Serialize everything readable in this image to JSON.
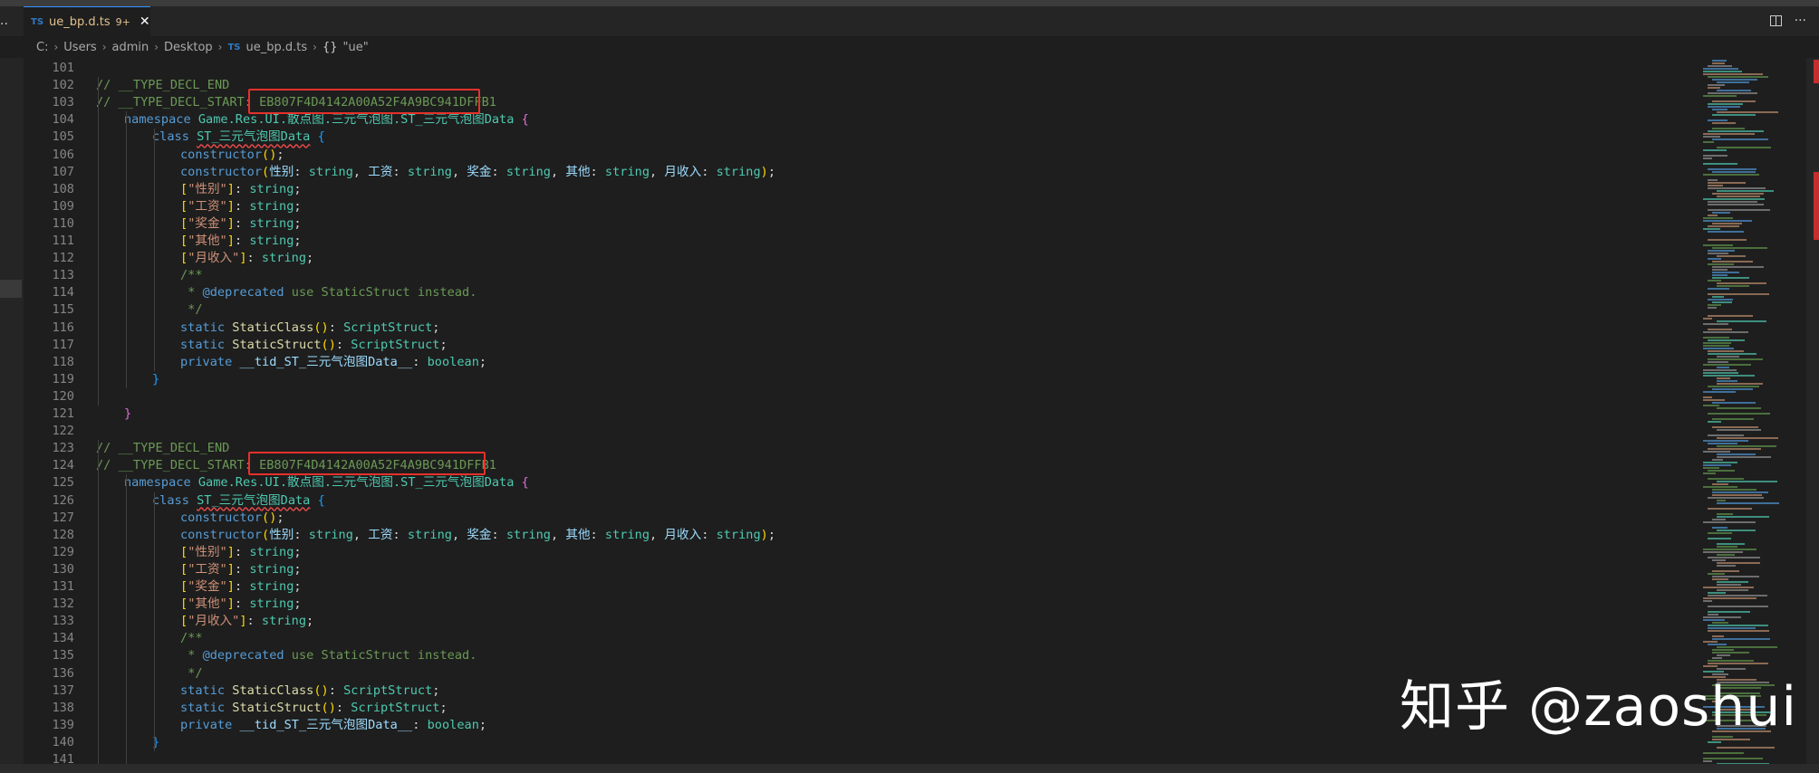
{
  "window": {
    "left_menu": "··"
  },
  "tab": {
    "lang_icon": "TS",
    "filename": "ue_bp.d.ts",
    "problems_badge": "9+",
    "close": "✕"
  },
  "tab_actions": {
    "more": "···"
  },
  "breadcrumb": {
    "items": [
      "C:",
      "Users",
      "admin",
      "Desktop",
      "ue_bp.d.ts",
      "\"ue\""
    ],
    "file_icon": "TS",
    "symbol_icon": "{}"
  },
  "editor": {
    "lines": [
      {
        "n": "101",
        "indent": 0,
        "tokens": []
      },
      {
        "n": "102",
        "indent": 0,
        "tokens": [
          [
            "c-cmt",
            "// __TYPE_DECL_END"
          ]
        ]
      },
      {
        "n": "103",
        "indent": 0,
        "tokens": [
          [
            "c-cmt",
            "// __TYPE_DECL_START: "
          ],
          [
            "c-hash",
            "EB807F4D4142A00A52F4A9BC941DFFB1"
          ]
        ]
      },
      {
        "n": "104",
        "indent": 1,
        "tokens": [
          [
            "c-kw",
            "namespace "
          ],
          [
            "c-type",
            "Game.Res.UI.散点图.三元气泡图.ST_三元气泡图Data "
          ],
          [
            "c-b2",
            "{"
          ]
        ]
      },
      {
        "n": "105",
        "indent": 2,
        "tokens": [
          [
            "c-kw",
            "class "
          ],
          [
            "c-type squig",
            "ST_三元气泡图Data"
          ],
          [
            "c-p",
            " "
          ],
          [
            "c-b3",
            "{"
          ]
        ]
      },
      {
        "n": "106",
        "indent": 3,
        "tokens": [
          [
            "c-kw",
            "constructor"
          ],
          [
            "c-b1",
            "()"
          ],
          [
            "c-p",
            ";"
          ]
        ]
      },
      {
        "n": "107",
        "indent": 3,
        "tokens": [
          [
            "c-kw",
            "constructor"
          ],
          [
            "c-b1",
            "("
          ],
          [
            "c-var",
            "性别"
          ],
          [
            "c-p",
            ": "
          ],
          [
            "c-type",
            "string"
          ],
          [
            "c-p",
            ", "
          ],
          [
            "c-var",
            "工资"
          ],
          [
            "c-p",
            ": "
          ],
          [
            "c-type",
            "string"
          ],
          [
            "c-p",
            ", "
          ],
          [
            "c-var",
            "奖金"
          ],
          [
            "c-p",
            ": "
          ],
          [
            "c-type",
            "string"
          ],
          [
            "c-p",
            ", "
          ],
          [
            "c-var",
            "其他"
          ],
          [
            "c-p",
            ": "
          ],
          [
            "c-type",
            "string"
          ],
          [
            "c-p",
            ", "
          ],
          [
            "c-var",
            "月收入"
          ],
          [
            "c-p",
            ": "
          ],
          [
            "c-type",
            "string"
          ],
          [
            "c-b1",
            ")"
          ],
          [
            "c-p",
            ";"
          ]
        ]
      },
      {
        "n": "108",
        "indent": 3,
        "tokens": [
          [
            "c-b1",
            "["
          ],
          [
            "c-str",
            "\"性别\""
          ],
          [
            "c-b1",
            "]"
          ],
          [
            "c-p",
            ": "
          ],
          [
            "c-type",
            "string"
          ],
          [
            "c-p",
            ";"
          ]
        ]
      },
      {
        "n": "109",
        "indent": 3,
        "tokens": [
          [
            "c-b1",
            "["
          ],
          [
            "c-str",
            "\"工资\""
          ],
          [
            "c-b1",
            "]"
          ],
          [
            "c-p",
            ": "
          ],
          [
            "c-type",
            "string"
          ],
          [
            "c-p",
            ";"
          ]
        ]
      },
      {
        "n": "110",
        "indent": 3,
        "tokens": [
          [
            "c-b1",
            "["
          ],
          [
            "c-str",
            "\"奖金\""
          ],
          [
            "c-b1",
            "]"
          ],
          [
            "c-p",
            ": "
          ],
          [
            "c-type",
            "string"
          ],
          [
            "c-p",
            ";"
          ]
        ]
      },
      {
        "n": "111",
        "indent": 3,
        "tokens": [
          [
            "c-b1",
            "["
          ],
          [
            "c-str",
            "\"其他\""
          ],
          [
            "c-b1",
            "]"
          ],
          [
            "c-p",
            ": "
          ],
          [
            "c-type",
            "string"
          ],
          [
            "c-p",
            ";"
          ]
        ]
      },
      {
        "n": "112",
        "indent": 3,
        "tokens": [
          [
            "c-b1",
            "["
          ],
          [
            "c-str",
            "\"月收入\""
          ],
          [
            "c-b1",
            "]"
          ],
          [
            "c-p",
            ": "
          ],
          [
            "c-type",
            "string"
          ],
          [
            "c-p",
            ";"
          ]
        ]
      },
      {
        "n": "113",
        "indent": 3,
        "tokens": [
          [
            "c-cmt",
            "/**"
          ]
        ]
      },
      {
        "n": "114",
        "indent": 3,
        "tokens": [
          [
            "c-cmt",
            " * "
          ],
          [
            "c-kw",
            "@deprecated"
          ],
          [
            "c-cmt",
            " use StaticStruct instead."
          ]
        ]
      },
      {
        "n": "115",
        "indent": 3,
        "tokens": [
          [
            "c-cmt",
            " */"
          ]
        ]
      },
      {
        "n": "116",
        "indent": 3,
        "tokens": [
          [
            "c-kw",
            "static "
          ],
          [
            "c-fn",
            "StaticClass"
          ],
          [
            "c-b1",
            "()"
          ],
          [
            "c-p",
            ": "
          ],
          [
            "c-type",
            "ScriptStruct"
          ],
          [
            "c-p",
            ";"
          ]
        ]
      },
      {
        "n": "117",
        "indent": 3,
        "tokens": [
          [
            "c-kw",
            "static "
          ],
          [
            "c-fn",
            "StaticStruct"
          ],
          [
            "c-b1",
            "()"
          ],
          [
            "c-p",
            ": "
          ],
          [
            "c-type",
            "ScriptStruct"
          ],
          [
            "c-p",
            ";"
          ]
        ]
      },
      {
        "n": "118",
        "indent": 3,
        "tokens": [
          [
            "c-kw",
            "private "
          ],
          [
            "c-var",
            "__tid_ST_三元气泡图Data__"
          ],
          [
            "c-p",
            ": "
          ],
          [
            "c-type",
            "boolean"
          ],
          [
            "c-p",
            ";"
          ]
        ]
      },
      {
        "n": "119",
        "indent": 2,
        "tokens": [
          [
            "c-b3",
            "}"
          ]
        ]
      },
      {
        "n": "120",
        "indent": 0,
        "tokens": []
      },
      {
        "n": "121",
        "indent": 1,
        "tokens": [
          [
            "c-b2",
            "}"
          ]
        ]
      },
      {
        "n": "122",
        "indent": 0,
        "tokens": []
      },
      {
        "n": "123",
        "indent": 0,
        "tokens": [
          [
            "c-cmt",
            "// __TYPE_DECL_END"
          ]
        ]
      },
      {
        "n": "124",
        "indent": 0,
        "tokens": [
          [
            "c-cmt",
            "// __TYPE_DECL_START: "
          ],
          [
            "c-hash",
            "EB807F4D4142A00A52F4A9BC941DFFB1"
          ]
        ]
      },
      {
        "n": "125",
        "indent": 1,
        "tokens": [
          [
            "c-kw",
            "namespace "
          ],
          [
            "c-type",
            "Game.Res.UI.散点图.三元气泡图.ST_三元气泡图Data "
          ],
          [
            "c-b2",
            "{"
          ]
        ]
      },
      {
        "n": "126",
        "indent": 2,
        "tokens": [
          [
            "c-kw",
            "class "
          ],
          [
            "c-type squig",
            "ST_三元气泡图Data"
          ],
          [
            "c-p",
            " "
          ],
          [
            "c-b3",
            "{"
          ]
        ]
      },
      {
        "n": "127",
        "indent": 3,
        "tokens": [
          [
            "c-kw",
            "constructor"
          ],
          [
            "c-b1",
            "()"
          ],
          [
            "c-p",
            ";"
          ]
        ]
      },
      {
        "n": "128",
        "indent": 3,
        "tokens": [
          [
            "c-kw",
            "constructor"
          ],
          [
            "c-b1",
            "("
          ],
          [
            "c-var",
            "性别"
          ],
          [
            "c-p",
            ": "
          ],
          [
            "c-type",
            "string"
          ],
          [
            "c-p",
            ", "
          ],
          [
            "c-var",
            "工资"
          ],
          [
            "c-p",
            ": "
          ],
          [
            "c-type",
            "string"
          ],
          [
            "c-p",
            ", "
          ],
          [
            "c-var",
            "奖金"
          ],
          [
            "c-p",
            ": "
          ],
          [
            "c-type",
            "string"
          ],
          [
            "c-p",
            ", "
          ],
          [
            "c-var",
            "其他"
          ],
          [
            "c-p",
            ": "
          ],
          [
            "c-type",
            "string"
          ],
          [
            "c-p",
            ", "
          ],
          [
            "c-var",
            "月收入"
          ],
          [
            "c-p",
            ": "
          ],
          [
            "c-type",
            "string"
          ],
          [
            "c-b1",
            ")"
          ],
          [
            "c-p",
            ";"
          ]
        ]
      },
      {
        "n": "129",
        "indent": 3,
        "tokens": [
          [
            "c-b1",
            "["
          ],
          [
            "c-str",
            "\"性别\""
          ],
          [
            "c-b1",
            "]"
          ],
          [
            "c-p",
            ": "
          ],
          [
            "c-type",
            "string"
          ],
          [
            "c-p",
            ";"
          ]
        ]
      },
      {
        "n": "130",
        "indent": 3,
        "tokens": [
          [
            "c-b1",
            "["
          ],
          [
            "c-str",
            "\"工资\""
          ],
          [
            "c-b1",
            "]"
          ],
          [
            "c-p",
            ": "
          ],
          [
            "c-type",
            "string"
          ],
          [
            "c-p",
            ";"
          ]
        ]
      },
      {
        "n": "131",
        "indent": 3,
        "tokens": [
          [
            "c-b1",
            "["
          ],
          [
            "c-str",
            "\"奖金\""
          ],
          [
            "c-b1",
            "]"
          ],
          [
            "c-p",
            ": "
          ],
          [
            "c-type",
            "string"
          ],
          [
            "c-p",
            ";"
          ]
        ]
      },
      {
        "n": "132",
        "indent": 3,
        "tokens": [
          [
            "c-b1",
            "["
          ],
          [
            "c-str",
            "\"其他\""
          ],
          [
            "c-b1",
            "]"
          ],
          [
            "c-p",
            ": "
          ],
          [
            "c-type",
            "string"
          ],
          [
            "c-p",
            ";"
          ]
        ]
      },
      {
        "n": "133",
        "indent": 3,
        "tokens": [
          [
            "c-b1",
            "["
          ],
          [
            "c-str",
            "\"月收入\""
          ],
          [
            "c-b1",
            "]"
          ],
          [
            "c-p",
            ": "
          ],
          [
            "c-type",
            "string"
          ],
          [
            "c-p",
            ";"
          ]
        ]
      },
      {
        "n": "134",
        "indent": 3,
        "tokens": [
          [
            "c-cmt",
            "/**"
          ]
        ]
      },
      {
        "n": "135",
        "indent": 3,
        "tokens": [
          [
            "c-cmt",
            " * "
          ],
          [
            "c-kw",
            "@deprecated"
          ],
          [
            "c-cmt",
            " use StaticStruct instead."
          ]
        ]
      },
      {
        "n": "136",
        "indent": 3,
        "tokens": [
          [
            "c-cmt",
            " */"
          ]
        ]
      },
      {
        "n": "137",
        "indent": 3,
        "tokens": [
          [
            "c-kw",
            "static "
          ],
          [
            "c-fn",
            "StaticClass"
          ],
          [
            "c-b1",
            "()"
          ],
          [
            "c-p",
            ": "
          ],
          [
            "c-type",
            "ScriptStruct"
          ],
          [
            "c-p",
            ";"
          ]
        ]
      },
      {
        "n": "138",
        "indent": 3,
        "tokens": [
          [
            "c-kw",
            "static "
          ],
          [
            "c-fn",
            "StaticStruct"
          ],
          [
            "c-b1",
            "()"
          ],
          [
            "c-p",
            ": "
          ],
          [
            "c-type",
            "ScriptStruct"
          ],
          [
            "c-p",
            ";"
          ]
        ]
      },
      {
        "n": "139",
        "indent": 3,
        "tokens": [
          [
            "c-kw",
            "private "
          ],
          [
            "c-var",
            "__tid_ST_三元气泡图Data__"
          ],
          [
            "c-p",
            ": "
          ],
          [
            "c-type",
            "boolean"
          ],
          [
            "c-p",
            ";"
          ]
        ]
      },
      {
        "n": "140",
        "indent": 2,
        "tokens": [
          [
            "c-b3",
            "}"
          ]
        ]
      },
      {
        "n": "141",
        "indent": 0,
        "tokens": []
      }
    ]
  },
  "watermark": "知乎 @zaoshui",
  "colors": {
    "editor_bg": "#1e1e1e",
    "highlight_box": "#e5312b",
    "tab_modified": "#e2c08d",
    "ts_icon": "#3178c6"
  }
}
